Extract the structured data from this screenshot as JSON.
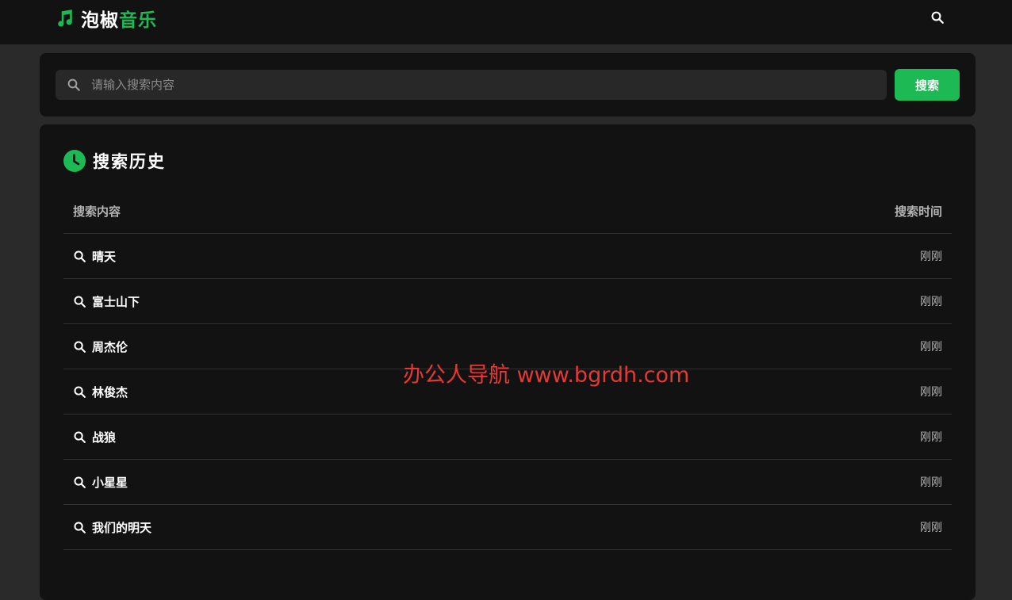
{
  "header": {
    "logo_icon": "music-note-icon",
    "logo_text_1": "泡椒",
    "logo_text_2": "音乐",
    "search_icon": "search-icon"
  },
  "search": {
    "placeholder": "请输入搜索内容",
    "value": "",
    "button_label": "搜索"
  },
  "history": {
    "title": "搜索历史",
    "title_icon": "clock-icon",
    "columns": [
      "搜索内容",
      "搜索时间"
    ],
    "rows": [
      {
        "query": "晴天",
        "time": "刚刚"
      },
      {
        "query": "富士山下",
        "time": "刚刚"
      },
      {
        "query": "周杰伦",
        "time": "刚刚"
      },
      {
        "query": "林俊杰",
        "time": "刚刚"
      },
      {
        "query": "战狼",
        "time": "刚刚"
      },
      {
        "query": "小星星",
        "time": "刚刚"
      },
      {
        "query": "我们的明天",
        "time": "刚刚"
      }
    ]
  },
  "watermark": "办公人导航 www.bgrdh.com",
  "colors": {
    "accent": "#1db954",
    "background": "#2a2a2a",
    "card": "#121212",
    "watermark": "#e53935"
  }
}
